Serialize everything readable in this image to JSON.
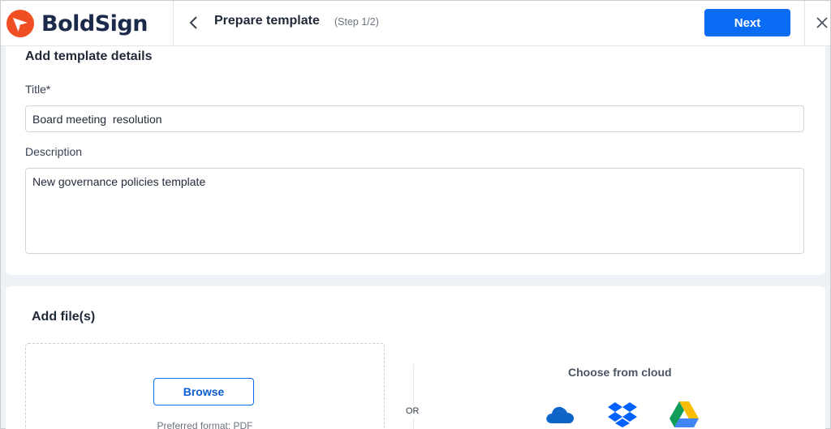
{
  "app": {
    "brand_name": "BoldSign",
    "brand_color": "#f04e23"
  },
  "header": {
    "title": "Prepare template",
    "step": "(Step 1/2)",
    "next_label": "Next"
  },
  "details": {
    "heading": "Add template details",
    "title_label": "Title*",
    "title_value": "Board meeting  resolution",
    "description_label": "Description",
    "description_value": "New governance policies template"
  },
  "files": {
    "heading": "Add file(s)",
    "browse_label": "Browse",
    "preferred_format": "Preferred format: PDF",
    "or_label": "OR",
    "cloud_title": "Choose from cloud",
    "cloud_providers": [
      "onedrive-icon",
      "dropbox-icon",
      "google-drive-icon"
    ]
  },
  "colors": {
    "accent": "#0a6cf5",
    "onedrive": "#0f64c8",
    "dropbox": "#0061fe"
  }
}
